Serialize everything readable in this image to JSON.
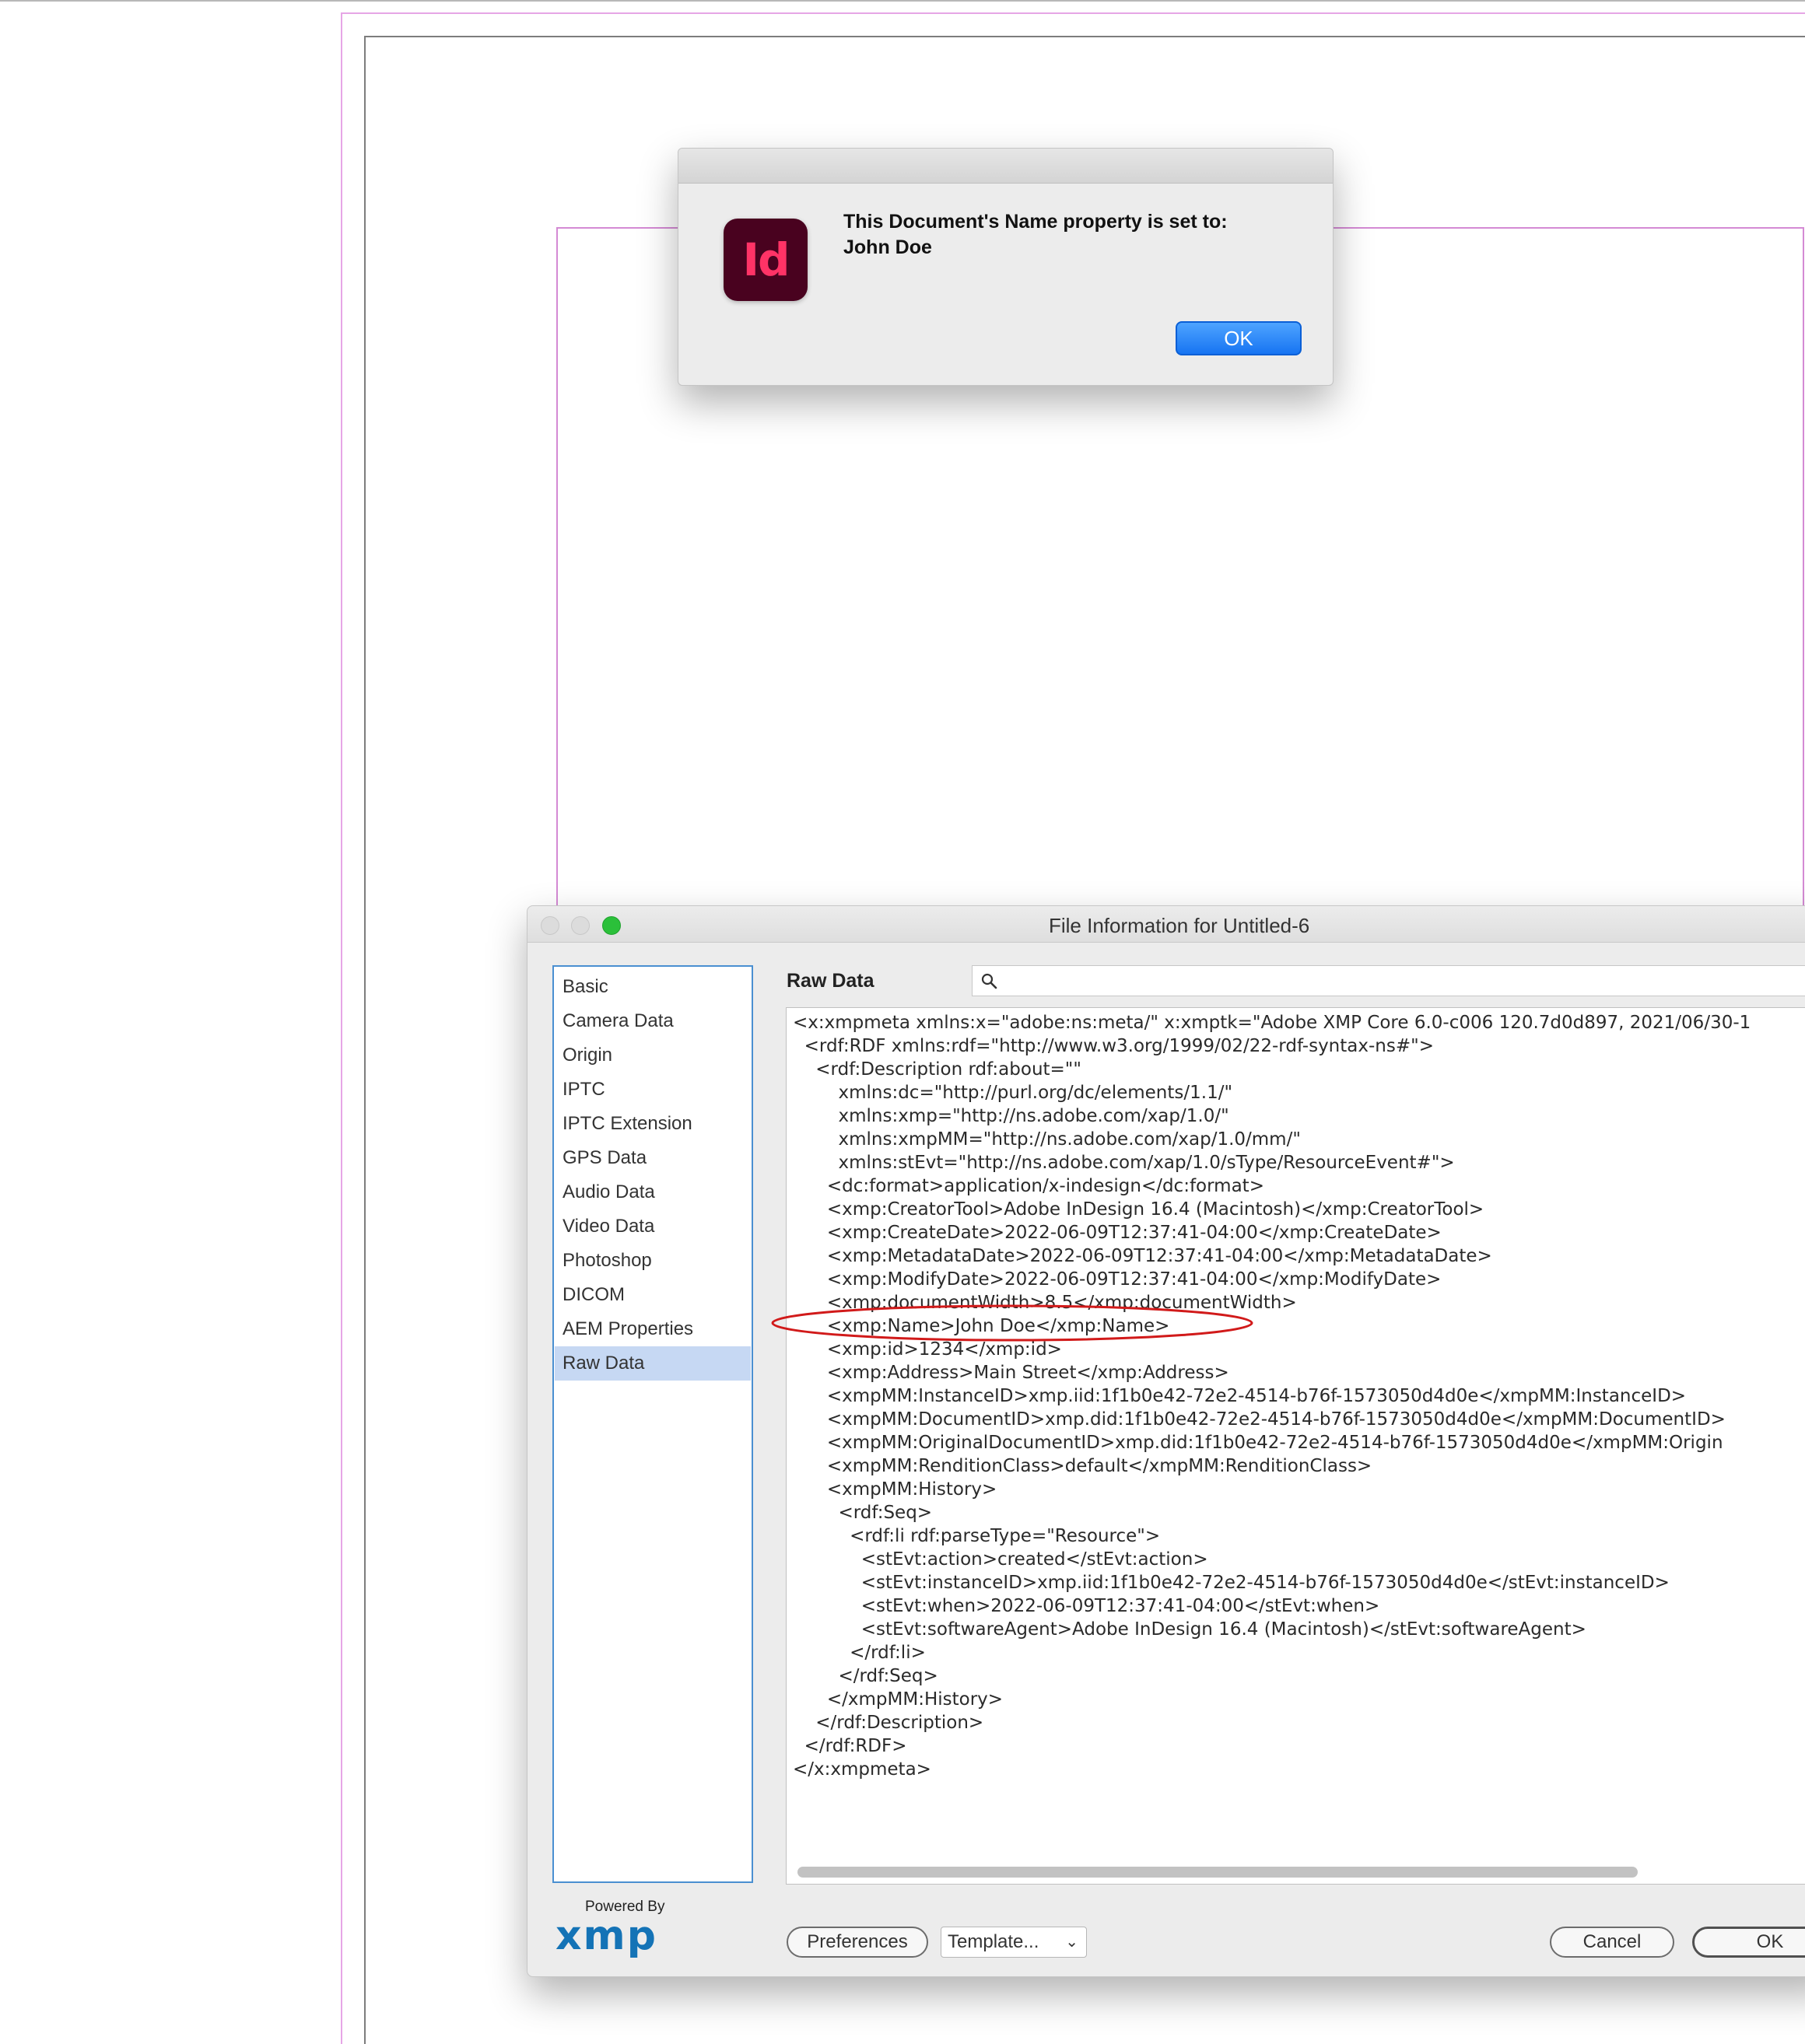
{
  "alert": {
    "app_icon_text": "Id",
    "message_line1": "This Document's Name property is set to:",
    "message_line2": "John Doe",
    "ok_label": "OK"
  },
  "file_info": {
    "window_title": "File Information for Untitled-6",
    "sidebar": [
      {
        "label": "Basic"
      },
      {
        "label": "Camera Data"
      },
      {
        "label": "Origin"
      },
      {
        "label": "IPTC"
      },
      {
        "label": "IPTC Extension"
      },
      {
        "label": "GPS Data"
      },
      {
        "label": "Audio Data"
      },
      {
        "label": "Video Data"
      },
      {
        "label": "Photoshop"
      },
      {
        "label": "DICOM"
      },
      {
        "label": "AEM Properties"
      },
      {
        "label": "Raw Data"
      }
    ],
    "selected_section": "Raw Data",
    "panel_heading": "Raw Data",
    "search_placeholder": "",
    "raw_lines": [
      "<x:xmpmeta xmlns:x=\"adobe:ns:meta/\" x:xmptk=\"Adobe XMP Core 6.0-c006 120.7d0d897, 2021/06/30-1",
      "  <rdf:RDF xmlns:rdf=\"http://www.w3.org/1999/02/22-rdf-syntax-ns#\">",
      "    <rdf:Description rdf:about=\"\"",
      "        xmlns:dc=\"http://purl.org/dc/elements/1.1/\"",
      "        xmlns:xmp=\"http://ns.adobe.com/xap/1.0/\"",
      "        xmlns:xmpMM=\"http://ns.adobe.com/xap/1.0/mm/\"",
      "        xmlns:stEvt=\"http://ns.adobe.com/xap/1.0/sType/ResourceEvent#\">",
      "      <dc:format>application/x-indesign</dc:format>",
      "      <xmp:CreatorTool>Adobe InDesign 16.4 (Macintosh)</xmp:CreatorTool>",
      "      <xmp:CreateDate>2022-06-09T12:37:41-04:00</xmp:CreateDate>",
      "      <xmp:MetadataDate>2022-06-09T12:37:41-04:00</xmp:MetadataDate>",
      "      <xmp:ModifyDate>2022-06-09T12:37:41-04:00</xmp:ModifyDate>",
      "      <xmp:documentWidth>8.5</xmp:documentWidth>",
      "      <xmp:Name>John Doe</xmp:Name>",
      "      <xmp:id>1234</xmp:id>",
      "      <xmp:Address>Main Street</xmp:Address>",
      "      <xmpMM:InstanceID>xmp.iid:1f1b0e42-72e2-4514-b76f-1573050d4d0e</xmpMM:InstanceID>",
      "      <xmpMM:DocumentID>xmp.did:1f1b0e42-72e2-4514-b76f-1573050d4d0e</xmpMM:DocumentID>",
      "      <xmpMM:OriginalDocumentID>xmp.did:1f1b0e42-72e2-4514-b76f-1573050d4d0e</xmpMM:Origin",
      "      <xmpMM:RenditionClass>default</xmpMM:RenditionClass>",
      "      <xmpMM:History>",
      "        <rdf:Seq>",
      "          <rdf:li rdf:parseType=\"Resource\">",
      "            <stEvt:action>created</stEvt:action>",
      "            <stEvt:instanceID>xmp.iid:1f1b0e42-72e2-4514-b76f-1573050d4d0e</stEvt:instanceID>",
      "            <stEvt:when>2022-06-09T12:37:41-04:00</stEvt:when>",
      "            <stEvt:softwareAgent>Adobe InDesign 16.4 (Macintosh)</stEvt:softwareAgent>",
      "          </rdf:li>",
      "        </rdf:Seq>",
      "      </xmpMM:History>",
      "    </rdf:Description>",
      "  </rdf:RDF>",
      "</x:xmpmeta>"
    ],
    "logo_caption": "Powered By",
    "logo_word": "xmp",
    "buttons": {
      "preferences": "Preferences",
      "template": "Template...",
      "cancel": "Cancel",
      "ok": "OK"
    }
  },
  "colors": {
    "accent_blue": "#1774f2",
    "highlight_ellipse": "#d11a1a",
    "indesign_icon_bg": "#49021f",
    "indesign_icon_text": "#ff3366",
    "selection": "#c6d8f3"
  }
}
